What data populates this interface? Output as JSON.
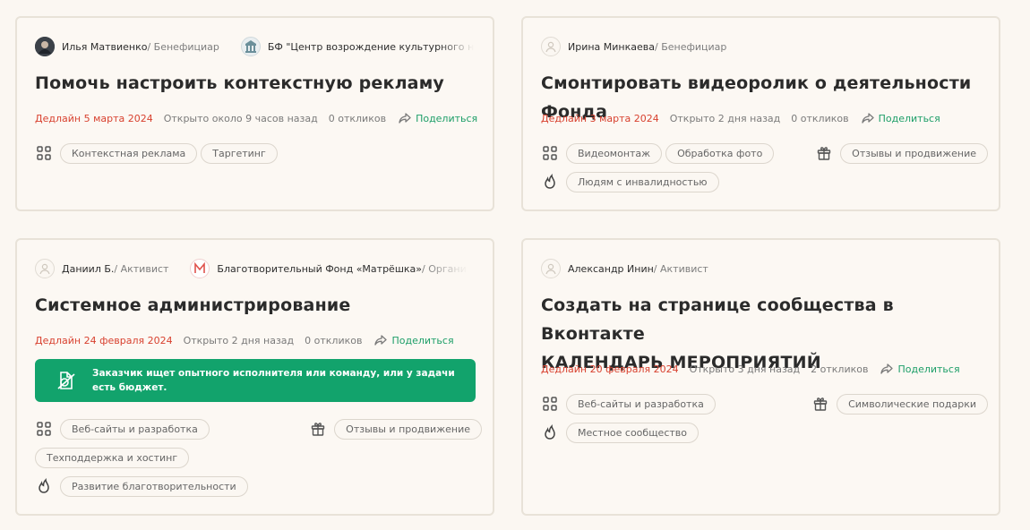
{
  "common": {
    "share_label": "Поделиться"
  },
  "cards": [
    {
      "people": [
        {
          "name": "Илья Матвиенко",
          "role": " / Бенефициар"
        },
        {
          "name": "БФ \"Центр возрождение культурного наследия",
          "role": ""
        }
      ],
      "title": "Помочь настроить контекстную рекламу",
      "deadline": "Дедлайн 5 марта 2024",
      "opened": "Открыто около 9 часов назад",
      "responses": "0 откликов",
      "skills": [
        "Контекстная реклама",
        "Таргетинг"
      ]
    },
    {
      "people": [
        {
          "name": "Ирина Минкаева",
          "role": " / Бенефициар"
        }
      ],
      "title": "Смонтировать видеоролик о деятельности Фонда",
      "deadline": "Дедлайн 3 марта 2024",
      "opened": "Открыто 2 дня назад",
      "responses": "0 откликов",
      "skills": [
        "Видеомонтаж",
        "Обработка фото"
      ],
      "rewards": [
        "Отзывы и продвижение"
      ],
      "causes": [
        "Людям с инвалидностью"
      ]
    },
    {
      "people": [
        {
          "name": "Даниил Б.",
          "role": " / Активист"
        },
        {
          "name": "Благотворительный Фонд «Матрёшка»",
          "role": " / Организация"
        }
      ],
      "title": "Системное администрирование",
      "deadline": "Дедлайн 24 февраля 2024",
      "opened": "Открыто 2 дня назад",
      "responses": "0 откликов",
      "banner": "Заказчик ищет опытного исполнителя или команду, или у задачи есть бюджет.",
      "skills": [
        "Веб-сайты и разработка",
        "Техподдержка и хостинг"
      ],
      "rewards": [
        "Отзывы и продвижение"
      ],
      "causes": [
        "Развитие благотворительности"
      ]
    },
    {
      "people": [
        {
          "name": "Александр Инин",
          "role": " / Активист"
        }
      ],
      "title_lines": [
        "Создать на странице сообщества в Вконтакте",
        "КАЛЕНДАРЬ МЕРОПРИЯТИЙ"
      ],
      "deadline": "Дедлайн 20 февраля 2024",
      "opened": "Открыто 3 дня назад",
      "responses": "2 откликов",
      "skills": [
        "Веб-сайты и разработка"
      ],
      "rewards": [
        "Символические подарки"
      ],
      "causes": [
        "Местное сообщество"
      ]
    }
  ]
}
